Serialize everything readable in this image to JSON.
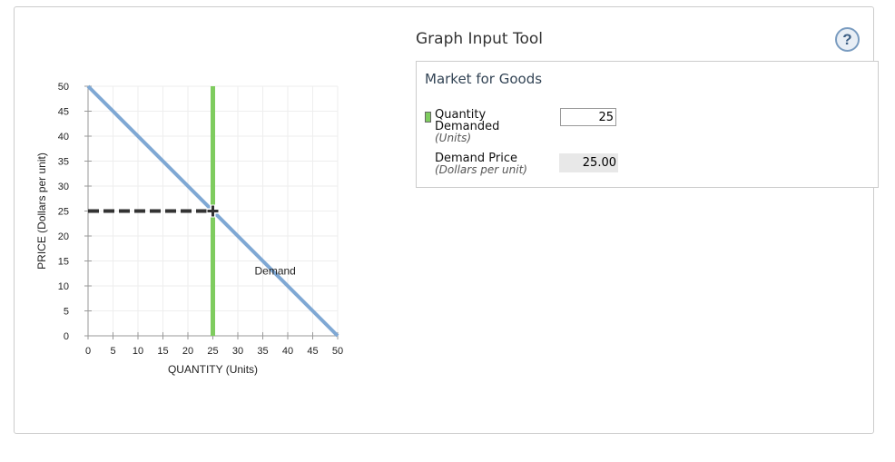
{
  "tool": {
    "title": "Graph Input Tool",
    "help_icon": "?"
  },
  "panel": {
    "title": "Market for Goods",
    "quantity": {
      "label_line1": "Quantity",
      "label_line2": "Demanded",
      "unit": "(Units)",
      "value": "25",
      "swatch_color": "#7fcc5f"
    },
    "price": {
      "label": "Demand Price",
      "unit": "(Dollars per unit)",
      "value": "25.00"
    }
  },
  "chart_data": {
    "type": "line",
    "xlabel": "QUANTITY (Units)",
    "ylabel": "PRICE (Dollars per unit)",
    "xlim": [
      0,
      50
    ],
    "ylim": [
      0,
      50
    ],
    "xticks": [
      0,
      5,
      10,
      15,
      20,
      25,
      30,
      35,
      40,
      45,
      50
    ],
    "yticks": [
      0,
      5,
      10,
      15,
      20,
      25,
      30,
      35,
      40,
      45,
      50
    ],
    "grid": true,
    "series": [
      {
        "name": "Demand",
        "label": "Demand",
        "x": [
          0,
          50
        ],
        "y": [
          50,
          0
        ],
        "color": "#7fa8d4"
      }
    ],
    "quantity_line": {
      "x": 25,
      "color": "#7fcc5f"
    },
    "price_line": {
      "y": 25,
      "color": "#333333"
    },
    "point": {
      "x": 25,
      "y": 25
    }
  }
}
